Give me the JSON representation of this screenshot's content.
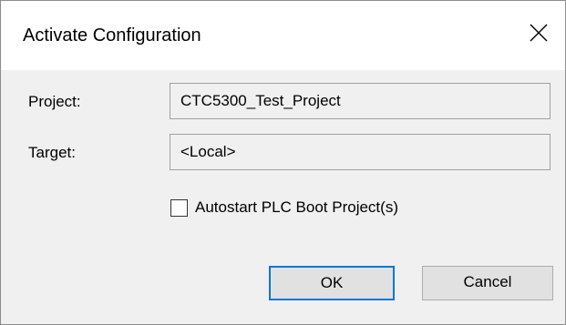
{
  "window": {
    "title": "Activate Configuration",
    "close_icon": "close-icon"
  },
  "form": {
    "project_label": "Project:",
    "project_value": "CTC5300_Test_Project",
    "target_label": "Target:",
    "target_value": "<Local>",
    "autostart_label": "Autostart PLC Boot Project(s)",
    "autostart_checked": false
  },
  "buttons": {
    "ok_label": "OK",
    "cancel_label": "Cancel"
  },
  "colors": {
    "accent": "#0078d7",
    "background": "#f0f0f0",
    "titlebar": "#ffffff"
  }
}
